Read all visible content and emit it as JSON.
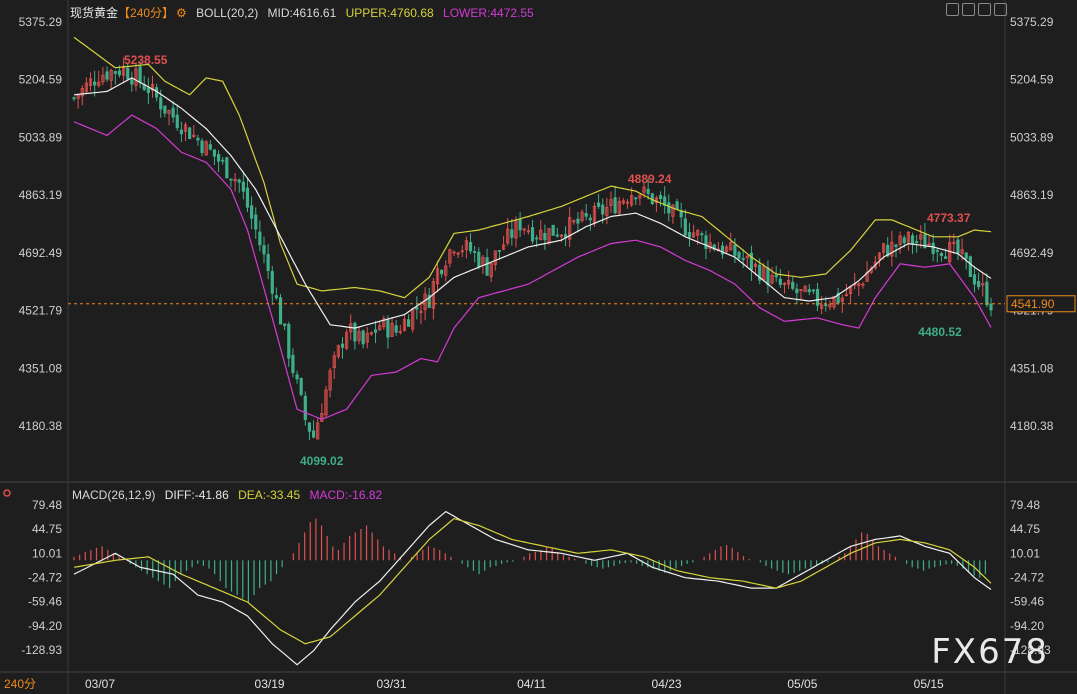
{
  "header": {
    "symbol": "现货黄金",
    "timeframe": "【240分】",
    "indicator": "BOLL(20,2)",
    "mid": "MID:4616.61",
    "upper": "UPPER:4760.68",
    "lower": "LOWER:4472.55"
  },
  "macd_header": {
    "name": "MACD(26,12,9)",
    "diff": "DIFF:-41.86",
    "dea": "DEA:-33.45",
    "macd": "MACD:-16.82"
  },
  "footer": {
    "timeframe_label": "240分",
    "watermark": "FX678"
  },
  "colors": {
    "background": "#1e1e1f",
    "up": "#e0504f",
    "down": "#3fae8a",
    "upper": "#d7d33a",
    "mid": "#f0f0f0",
    "lower": "#d63ad6",
    "price_line": "#f08a1c",
    "grid": "#3a3a3a"
  },
  "chart_data": [
    {
      "type": "candlestick",
      "title": "现货黄金 240分",
      "y_ticks": [
        "5375.29",
        "5204.59",
        "5033.89",
        "4863.19",
        "4692.49",
        "4521.79",
        "4351.08",
        "4180.38"
      ],
      "ylim": [
        4100,
        5400
      ],
      "x_ticks": [
        "03/07",
        "03/19",
        "03/31",
        "04/11",
        "04/23",
        "05/05",
        "05/15"
      ],
      "current_price": "4541.90",
      "annotations": [
        {
          "label": "5238.55",
          "kind": "high"
        },
        {
          "label": "4099.02",
          "kind": "low"
        },
        {
          "label": "4889.24",
          "kind": "high"
        },
        {
          "label": "4773.37",
          "kind": "high"
        },
        {
          "label": "4480.52",
          "kind": "low"
        }
      ],
      "close_path": [
        [
          0,
          5150
        ],
        [
          6,
          5220
        ],
        [
          12,
          5238
        ],
        [
          18,
          5180
        ],
        [
          22,
          5120
        ],
        [
          28,
          5050
        ],
        [
          34,
          4980
        ],
        [
          40,
          4900
        ],
        [
          44,
          4760
        ],
        [
          48,
          4600
        ],
        [
          52,
          4400
        ],
        [
          56,
          4200
        ],
        [
          58,
          4150
        ],
        [
          62,
          4330
        ],
        [
          66,
          4470
        ],
        [
          70,
          4420
        ],
        [
          74,
          4480
        ],
        [
          78,
          4460
        ],
        [
          82,
          4520
        ],
        [
          86,
          4560
        ],
        [
          88,
          4640
        ],
        [
          92,
          4720
        ],
        [
          96,
          4700
        ],
        [
          100,
          4650
        ],
        [
          104,
          4720
        ],
        [
          108,
          4780
        ],
        [
          112,
          4750
        ],
        [
          118,
          4760
        ],
        [
          124,
          4790
        ],
        [
          130,
          4830
        ],
        [
          136,
          4880
        ],
        [
          142,
          4840
        ],
        [
          148,
          4770
        ],
        [
          154,
          4720
        ],
        [
          160,
          4690
        ],
        [
          166,
          4640
        ],
        [
          170,
          4600
        ],
        [
          174,
          4580
        ],
        [
          180,
          4550
        ],
        [
          186,
          4560
        ],
        [
          190,
          4600
        ],
        [
          196,
          4700
        ],
        [
          202,
          4730
        ],
        [
          208,
          4720
        ],
        [
          214,
          4690
        ],
        [
          218,
          4620
        ],
        [
          222,
          4545
        ]
      ],
      "boll": {
        "upper": [
          [
            0,
            5330
          ],
          [
            10,
            5240
          ],
          [
            18,
            5250
          ],
          [
            22,
            5200
          ],
          [
            28,
            5160
          ],
          [
            32,
            5210
          ],
          [
            36,
            5200
          ],
          [
            40,
            5100
          ],
          [
            46,
            4900
          ],
          [
            50,
            4720
          ],
          [
            54,
            4600
          ],
          [
            60,
            4580
          ],
          [
            68,
            4590
          ],
          [
            74,
            4580
          ],
          [
            80,
            4560
          ],
          [
            86,
            4620
          ],
          [
            92,
            4750
          ],
          [
            98,
            4760
          ],
          [
            104,
            4780
          ],
          [
            110,
            4800
          ],
          [
            118,
            4830
          ],
          [
            124,
            4860
          ],
          [
            130,
            4890
          ],
          [
            136,
            4875
          ],
          [
            140,
            4850
          ],
          [
            146,
            4820
          ],
          [
            152,
            4800
          ],
          [
            158,
            4740
          ],
          [
            164,
            4680
          ],
          [
            170,
            4630
          ],
          [
            176,
            4620
          ],
          [
            182,
            4630
          ],
          [
            188,
            4700
          ],
          [
            194,
            4790
          ],
          [
            198,
            4790
          ],
          [
            204,
            4760
          ],
          [
            208,
            4740
          ],
          [
            214,
            4740
          ],
          [
            218,
            4760
          ],
          [
            222,
            4755
          ]
        ],
        "mid": [
          [
            0,
            5160
          ],
          [
            8,
            5170
          ],
          [
            14,
            5210
          ],
          [
            20,
            5170
          ],
          [
            26,
            5120
          ],
          [
            32,
            5060
          ],
          [
            38,
            4980
          ],
          [
            44,
            4880
          ],
          [
            50,
            4740
          ],
          [
            56,
            4600
          ],
          [
            62,
            4480
          ],
          [
            68,
            4470
          ],
          [
            74,
            4490
          ],
          [
            80,
            4510
          ],
          [
            86,
            4560
          ],
          [
            92,
            4620
          ],
          [
            98,
            4650
          ],
          [
            104,
            4680
          ],
          [
            110,
            4710
          ],
          [
            118,
            4730
          ],
          [
            124,
            4770
          ],
          [
            130,
            4800
          ],
          [
            136,
            4810
          ],
          [
            142,
            4780
          ],
          [
            148,
            4740
          ],
          [
            154,
            4710
          ],
          [
            160,
            4680
          ],
          [
            166,
            4620
          ],
          [
            172,
            4560
          ],
          [
            178,
            4550
          ],
          [
            184,
            4560
          ],
          [
            190,
            4610
          ],
          [
            196,
            4680
          ],
          [
            202,
            4720
          ],
          [
            208,
            4710
          ],
          [
            214,
            4690
          ],
          [
            218,
            4650
          ],
          [
            222,
            4617
          ]
        ],
        "lower": [
          [
            0,
            5080
          ],
          [
            8,
            5040
          ],
          [
            14,
            5100
          ],
          [
            20,
            5060
          ],
          [
            26,
            4990
          ],
          [
            32,
            4960
          ],
          [
            38,
            4880
          ],
          [
            42,
            4760
          ],
          [
            48,
            4500
          ],
          [
            54,
            4230
          ],
          [
            60,
            4200
          ],
          [
            66,
            4230
          ],
          [
            72,
            4330
          ],
          [
            78,
            4340
          ],
          [
            84,
            4380
          ],
          [
            88,
            4370
          ],
          [
            92,
            4470
          ],
          [
            98,
            4560
          ],
          [
            104,
            4580
          ],
          [
            110,
            4600
          ],
          [
            116,
            4640
          ],
          [
            122,
            4680
          ],
          [
            130,
            4720
          ],
          [
            136,
            4730
          ],
          [
            142,
            4710
          ],
          [
            148,
            4670
          ],
          [
            154,
            4640
          ],
          [
            160,
            4600
          ],
          [
            166,
            4530
          ],
          [
            172,
            4490
          ],
          [
            180,
            4500
          ],
          [
            186,
            4480
          ],
          [
            190,
            4470
          ],
          [
            194,
            4560
          ],
          [
            200,
            4660
          ],
          [
            206,
            4650
          ],
          [
            212,
            4660
          ],
          [
            218,
            4560
          ],
          [
            222,
            4472
          ]
        ]
      }
    },
    {
      "type": "bar",
      "title": "MACD(26,12,9)",
      "y_ticks": [
        "79.48",
        "44.75",
        "10.01",
        "-24.72",
        "-59.46",
        "-94.20",
        "-128.93"
      ],
      "ylim": [
        -145,
        90
      ],
      "series": [
        {
          "name": "DIFF",
          "values": [
            [
              0,
              -20
            ],
            [
              10,
              10
            ],
            [
              16,
              -10
            ],
            [
              24,
              -20
            ],
            [
              30,
              -50
            ],
            [
              36,
              -60
            ],
            [
              42,
              -80
            ],
            [
              48,
              -120
            ],
            [
              54,
              -150
            ],
            [
              58,
              -130
            ],
            [
              62,
              -100
            ],
            [
              68,
              -60
            ],
            [
              74,
              -30
            ],
            [
              80,
              10
            ],
            [
              86,
              50
            ],
            [
              90,
              70
            ],
            [
              96,
              50
            ],
            [
              102,
              30
            ],
            [
              110,
              15
            ],
            [
              118,
              10
            ],
            [
              126,
              0
            ],
            [
              134,
              10
            ],
            [
              140,
              -10
            ],
            [
              148,
              -25
            ],
            [
              156,
              -30
            ],
            [
              164,
              -40
            ],
            [
              170,
              -40
            ],
            [
              176,
              -20
            ],
            [
              182,
              0
            ],
            [
              188,
              20
            ],
            [
              194,
              30
            ],
            [
              200,
              35
            ],
            [
              206,
              20
            ],
            [
              212,
              10
            ],
            [
              218,
              -25
            ],
            [
              222,
              -42
            ]
          ]
        },
        {
          "name": "DEA",
          "values": [
            [
              0,
              -10
            ],
            [
              10,
              0
            ],
            [
              18,
              5
            ],
            [
              26,
              -20
            ],
            [
              34,
              -40
            ],
            [
              42,
              -60
            ],
            [
              50,
              -100
            ],
            [
              56,
              -120
            ],
            [
              62,
              -110
            ],
            [
              68,
              -80
            ],
            [
              74,
              -50
            ],
            [
              80,
              -10
            ],
            [
              86,
              30
            ],
            [
              92,
              60
            ],
            [
              98,
              50
            ],
            [
              106,
              30
            ],
            [
              114,
              20
            ],
            [
              122,
              10
            ],
            [
              130,
              15
            ],
            [
              138,
              5
            ],
            [
              146,
              -15
            ],
            [
              154,
              -25
            ],
            [
              162,
              -30
            ],
            [
              170,
              -40
            ],
            [
              176,
              -30
            ],
            [
              182,
              -10
            ],
            [
              188,
              10
            ],
            [
              194,
              25
            ],
            [
              200,
              30
            ],
            [
              206,
              25
            ],
            [
              212,
              15
            ],
            [
              218,
              -10
            ],
            [
              222,
              -33
            ]
          ]
        }
      ],
      "histogram": [
        5,
        8,
        12,
        15,
        18,
        20,
        15,
        10,
        5,
        0,
        -5,
        -10,
        -15,
        -20,
        -25,
        -30,
        -35,
        -40,
        -30,
        -20,
        -15,
        -10,
        -5,
        -8,
        -12,
        -20,
        -30,
        -40,
        -45,
        -50,
        -55,
        -60,
        -50,
        -40,
        -35,
        -30,
        -20,
        -10,
        0,
        10,
        25,
        40,
        55,
        60,
        50,
        35,
        20,
        15,
        25,
        35,
        40,
        45,
        50,
        40,
        30,
        20,
        15,
        10,
        5,
        0,
        5,
        10,
        15,
        20,
        18,
        15,
        10,
        5,
        0,
        -5,
        -10,
        -15,
        -20,
        -15,
        -10,
        -8,
        -5,
        -3,
        -2,
        0,
        5,
        10,
        12,
        15,
        20,
        18,
        12,
        8,
        5,
        2,
        0,
        -5,
        -8,
        -10,
        -12,
        -10,
        -8,
        -5,
        -4,
        -3,
        -5,
        -8,
        -10,
        -12,
        -15,
        -18,
        -15,
        -12,
        -8,
        -5,
        -3,
        0,
        5,
        10,
        15,
        20,
        22,
        18,
        12,
        6,
        2,
        0,
        -3,
        -8,
        -12,
        -15,
        -18,
        -20,
        -18,
        -15,
        -12,
        -10,
        -8,
        -5,
        -3,
        0,
        5,
        10,
        20,
        30,
        40,
        38,
        30,
        20,
        15,
        10,
        5,
        0,
        -5,
        -10,
        -12,
        -15,
        -12,
        -10,
        -8,
        -6,
        -5,
        -8,
        -12,
        -18,
        -22,
        -25,
        -20
      ]
    }
  ]
}
